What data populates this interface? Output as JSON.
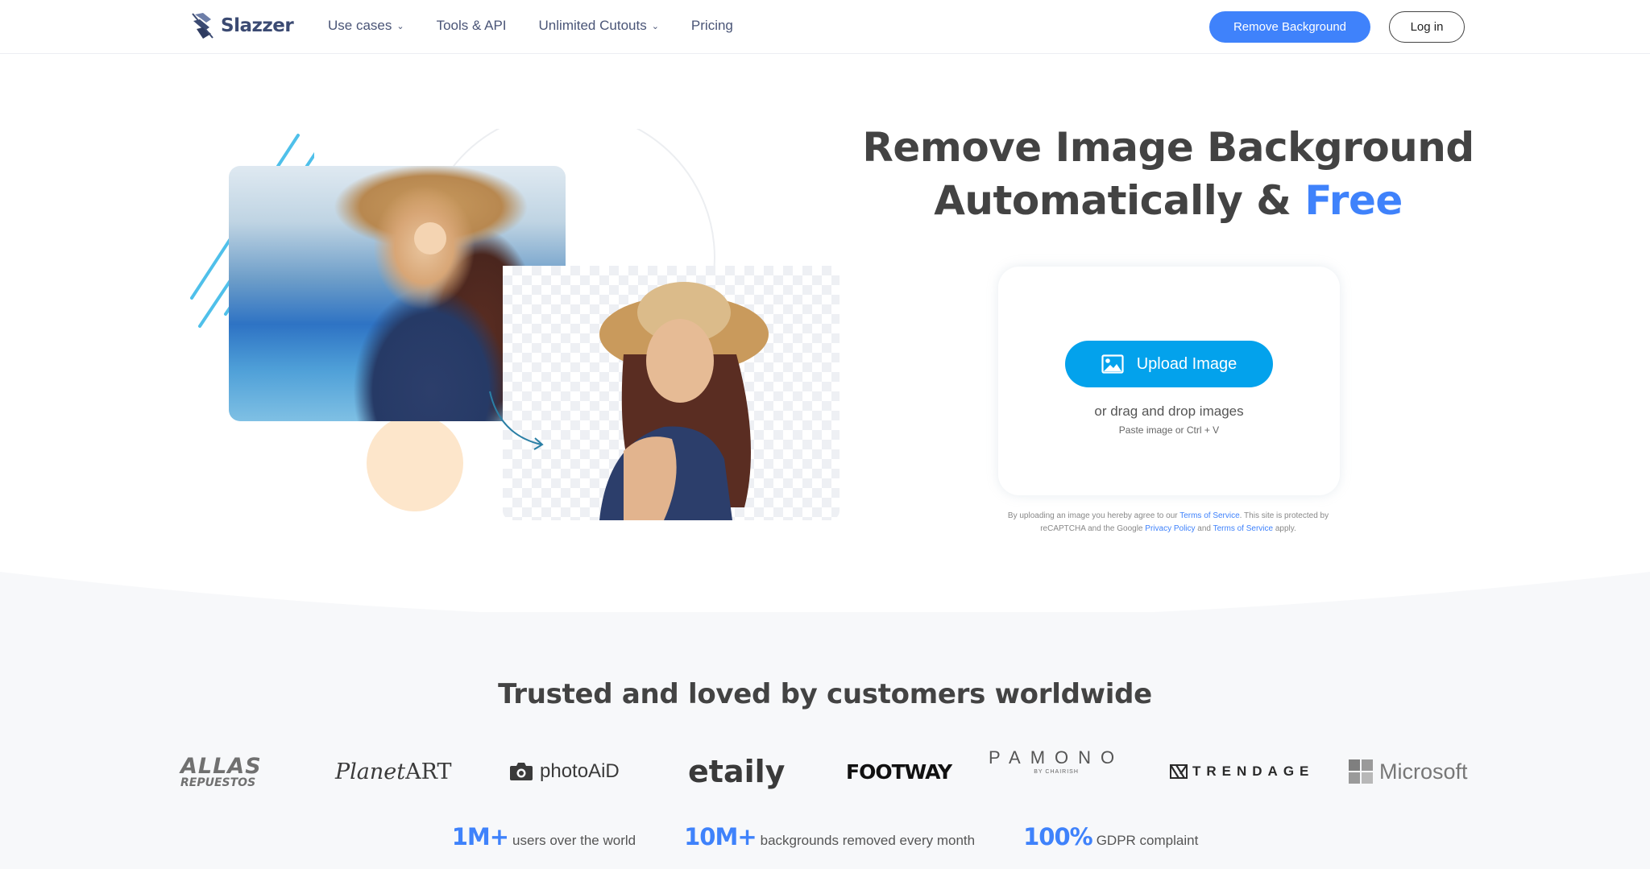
{
  "nav": {
    "brand": "Slazzer",
    "links": [
      {
        "label": "Use cases",
        "has_dropdown": true
      },
      {
        "label": "Tools & API",
        "has_dropdown": false
      },
      {
        "label": "Unlimited Cutouts",
        "has_dropdown": true
      },
      {
        "label": "Pricing",
        "has_dropdown": false
      }
    ],
    "remove_bg_label": "Remove Background",
    "login_label": "Log in"
  },
  "hero": {
    "title_line1": "Remove Image Background",
    "title_line2_prefix": "Automatically &",
    "title_line2_accent": "Free",
    "upload_label": "Upload Image",
    "upload_icon": "image-icon",
    "drag_text": "or drag and drop images",
    "paste_text": "Paste image or Ctrl + V",
    "legal": {
      "part1": "By uploading an image you hereby agree to our ",
      "link1": "Terms of Service",
      "part2": ". This site is protected by reCAPTCHA and the Google ",
      "link2": "Privacy Policy",
      "part3": " and ",
      "link3": "Terms of Service",
      "part4": " apply."
    },
    "images": {
      "original_alt": "Woman in straw hat with harbor background",
      "cutout_alt": "Woman in straw hat with transparent background"
    }
  },
  "trusted": {
    "title": "Trusted and loved by customers worldwide",
    "brands": [
      {
        "name": "ALLAS",
        "sub": "REPUESTOS"
      },
      {
        "name_a": "Planet",
        "name_b": "ART"
      },
      {
        "name": "photoAiD"
      },
      {
        "name": "etaily"
      },
      {
        "name": "FOOTWAY"
      },
      {
        "name": "PAMONO",
        "sub": "BY CHAIRISH"
      },
      {
        "name": "TRENDAGE"
      },
      {
        "name": "Microsoft"
      }
    ]
  },
  "stats": [
    {
      "value": "1M+",
      "label": "users over the world"
    },
    {
      "value": "10M+",
      "label": "backgrounds removed every month"
    },
    {
      "value": "100%",
      "label": "GDPR complaint"
    }
  ],
  "colors": {
    "accent": "#3f82fb",
    "upload_button": "#03a2ec",
    "heading": "#434343",
    "lower_bg": "#f7f8fa",
    "peach": "#fde6cb"
  }
}
